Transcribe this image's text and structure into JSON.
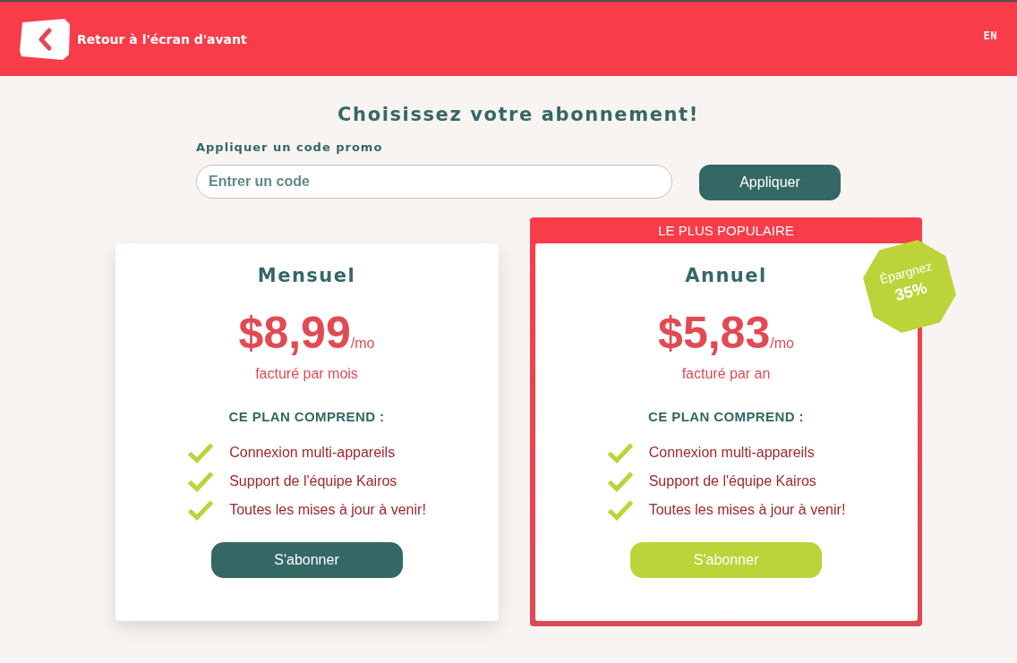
{
  "header": {
    "back_label": "Retour à l'écran d'avant",
    "language": "EN"
  },
  "title": "Choisissez votre abonnement!",
  "promo": {
    "label": "Appliquer un code promo",
    "placeholder": "Entrer un code",
    "button": "Appliquer"
  },
  "plans": [
    {
      "name": "Mensuel",
      "featured": false,
      "price": "$8,99",
      "unit": "/mo",
      "billing": "facturé par mois",
      "includes_heading": "CE PLAN COMPREND :",
      "features": [
        "Connexion multi-appareils",
        "Support de l'équipe Kairos",
        "Toutes les mises à jour à venir!"
      ],
      "button": "S'abonner"
    },
    {
      "name": "Annuel",
      "featured": true,
      "ribbon": "LE PLUS POPULAIRE",
      "badge": {
        "line_1": "Épargnez",
        "line_2": "35%"
      },
      "price": "$5,83",
      "unit": "/mo",
      "billing": "facturé par an",
      "includes_heading": "CE PLAN COMPREND :",
      "features": [
        "Connexion multi-appareils",
        "Support de l'équipe Kairos",
        "Toutes les mises à jour à venir!"
      ],
      "button": "S'abonner"
    }
  ]
}
